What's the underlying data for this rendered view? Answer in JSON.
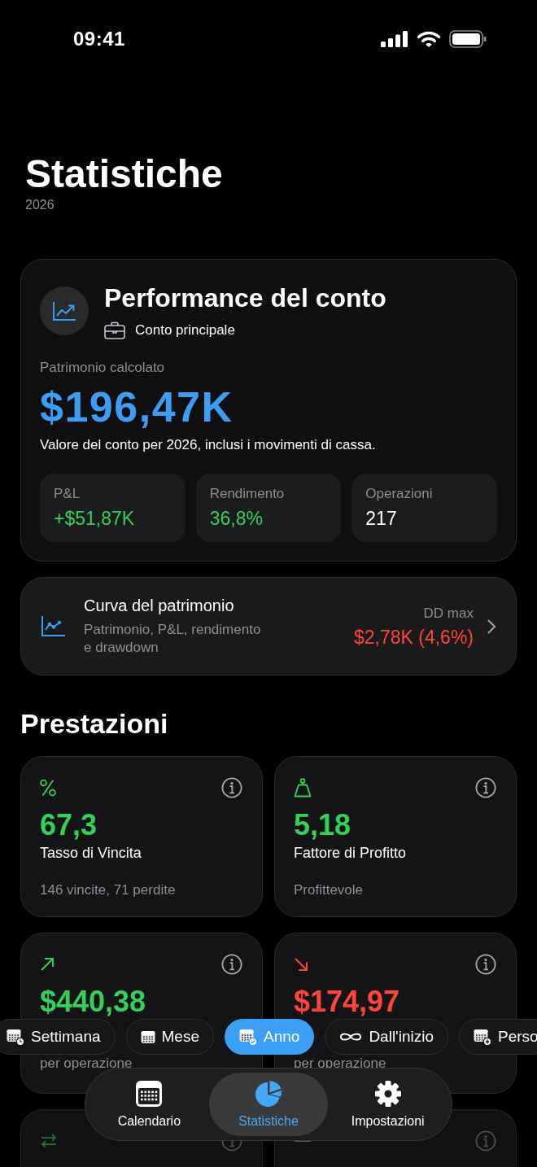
{
  "status_bar": {
    "time": "09:41"
  },
  "header": {
    "title": "Statistiche",
    "subtitle": "2026"
  },
  "performance_card": {
    "title": "Performance del conto",
    "account": "Conto principale",
    "label": "Patrimonio calcolato",
    "value": "$196,47K",
    "description": "Valore del conto per 2026, inclusi i movimenti di cassa.",
    "stats": [
      {
        "label": "P&L",
        "value": "+$51,87K",
        "color": "#32d158"
      },
      {
        "label": "Rendimento",
        "value": "36,8%",
        "color": "#32d158"
      },
      {
        "label": "Operazioni",
        "value": "217",
        "color": "#ffffff"
      }
    ]
  },
  "equity_curve_card": {
    "title": "Curva del patrimonio",
    "subtitle": "Patrimonio, P&L, rendimento e drawdown",
    "drawdown_label": "DD max",
    "drawdown_value": "$2,78K (4,6%)"
  },
  "performance_section": {
    "title": "Prestazioni",
    "metrics": [
      {
        "kind": "percent",
        "color": "#32d158",
        "value": "67,3",
        "label": "Tasso di Vincita",
        "detail": "146 vincite, 71 perdite"
      },
      {
        "kind": "scale",
        "color": "#32d158",
        "value": "5,18",
        "label": "Fattore di Profitto",
        "detail": "Profittevole"
      },
      {
        "kind": "up",
        "color": "#32d158",
        "value": "$440,38",
        "detail": "per operazione"
      },
      {
        "kind": "down",
        "color": "#ff453a",
        "value": "$174,97",
        "detail": "per operazione"
      },
      {
        "kind": "swap",
        "color": "#1f6b34"
      },
      {
        "kind": "dash",
        "color": "#5a5a5e"
      }
    ]
  },
  "period_filters": [
    {
      "kind": "week",
      "label": "Settimana",
      "selected": false
    },
    {
      "kind": "month",
      "label": "Mese",
      "selected": false
    },
    {
      "kind": "year",
      "label": "Anno",
      "selected": true
    },
    {
      "kind": "all",
      "label": "Dall'inizio",
      "selected": false
    },
    {
      "kind": "custom",
      "label": "Perso",
      "selected": false
    }
  ],
  "tab_bar": [
    {
      "kind": "calendar",
      "label": "Calendario",
      "selected": false
    },
    {
      "kind": "stats",
      "label": "Statistiche",
      "selected": true
    },
    {
      "kind": "settings",
      "label": "Impostazioni",
      "selected": false
    }
  ]
}
